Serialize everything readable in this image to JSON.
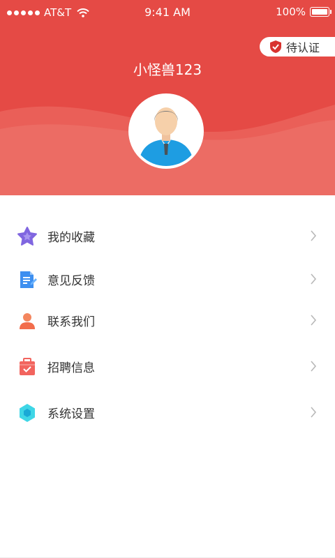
{
  "status_bar": {
    "carrier": "AT&T",
    "time": "9:41 AM",
    "battery": "100%"
  },
  "badge": {
    "label": "待认证"
  },
  "profile": {
    "username": "小怪兽123"
  },
  "menu": {
    "items": [
      {
        "label": "我的收藏",
        "icon": "star-icon"
      },
      {
        "label": "意见反馈",
        "icon": "feedback-document-icon"
      },
      {
        "label": "联系我们",
        "icon": "person-icon"
      },
      {
        "label": "招聘信息",
        "icon": "briefcase-check-icon"
      },
      {
        "label": "系统设置",
        "icon": "hexagon-settings-icon"
      }
    ]
  },
  "colors": {
    "header": "#e54a45",
    "wave": "#ec6c64",
    "text": "#333333",
    "chevron": "#b8b8b8"
  }
}
